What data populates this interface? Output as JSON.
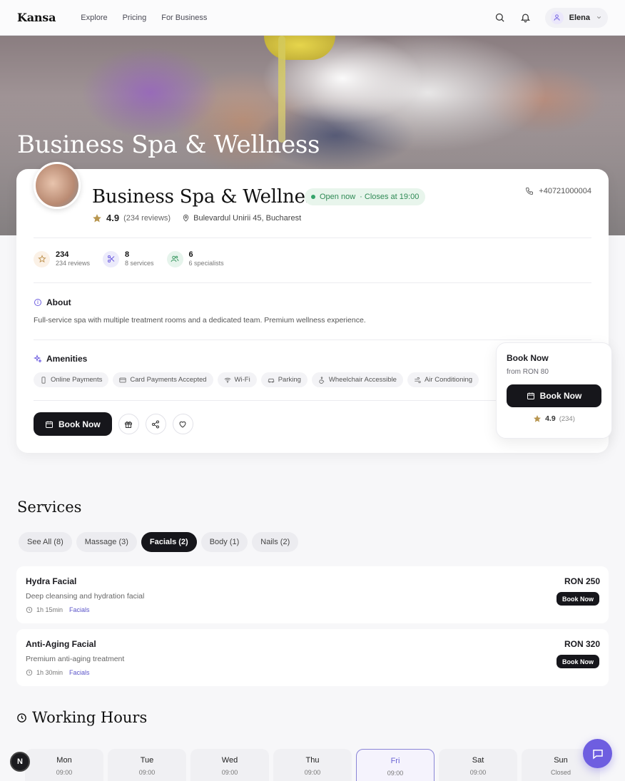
{
  "nav": {
    "brand": "Kansa",
    "links": [
      "Explore",
      "Pricing",
      "For Business"
    ],
    "user_name": "Elena"
  },
  "hero": {
    "title": "Business Spa & Wellness"
  },
  "business": {
    "name": "Business Spa & Wellness",
    "status": "Open now",
    "closes": "· Closes at 19:00",
    "phone": "+40721000004",
    "rating": "4.9",
    "reviews": "(234 reviews)",
    "address": "Bulevardul Unirii 45, Bucharest"
  },
  "stats": [
    {
      "num": "234",
      "label": "234 reviews",
      "icon": "star-icon"
    },
    {
      "num": "8",
      "label": "8 services",
      "icon": "scissors-icon"
    },
    {
      "num": "6",
      "label": "6 specialists",
      "icon": "people-icon"
    }
  ],
  "about": {
    "heading": "About",
    "text": "Full-service spa with multiple treatment rooms and a dedicated team. Premium wellness experience."
  },
  "amenities": {
    "heading": "Amenities",
    "items": [
      "Online Payments",
      "Card Payments Accepted",
      "Wi-Fi",
      "Parking",
      "Wheelchair Accessible",
      "Air Conditioning"
    ]
  },
  "actions": {
    "book_label": "Book Now"
  },
  "booking_widget": {
    "title": "Book Now",
    "from": "from RON 80",
    "button": "Book Now",
    "rating": "4.9",
    "count": "(234)"
  },
  "services": {
    "title": "Services",
    "filters": [
      "See All (8)",
      "Massage (3)",
      "Facials (2)",
      "Body (1)",
      "Nails (2)"
    ],
    "active_filter": "Facials (2)",
    "items": [
      {
        "name": "Hydra Facial",
        "desc": "Deep cleansing and hydration facial",
        "duration": "1h 15min",
        "category": "Facials",
        "price": "RON 250",
        "book": "Book Now"
      },
      {
        "name": "Anti-Aging Facial",
        "desc": "Premium anti-aging treatment",
        "duration": "1h 30min",
        "category": "Facials",
        "price": "RON 320",
        "book": "Book Now"
      }
    ]
  },
  "working_hours": {
    "title": "Working Hours",
    "days": [
      {
        "name": "Mon",
        "time": "09:00"
      },
      {
        "name": "Tue",
        "time": "09:00"
      },
      {
        "name": "Wed",
        "time": "09:00"
      },
      {
        "name": "Thu",
        "time": "09:00"
      },
      {
        "name": "Fri",
        "time": "09:00"
      },
      {
        "name": "Sat",
        "time": "09:00"
      },
      {
        "name": "Sun",
        "time": "Closed"
      }
    ],
    "today": "Fri"
  },
  "fab": {
    "n_label": "N"
  },
  "colors": {
    "accent": "#6e5ee0",
    "dark_button": "#16161b",
    "open_green": "#2f8a55",
    "star_gold": "#b8964f"
  }
}
